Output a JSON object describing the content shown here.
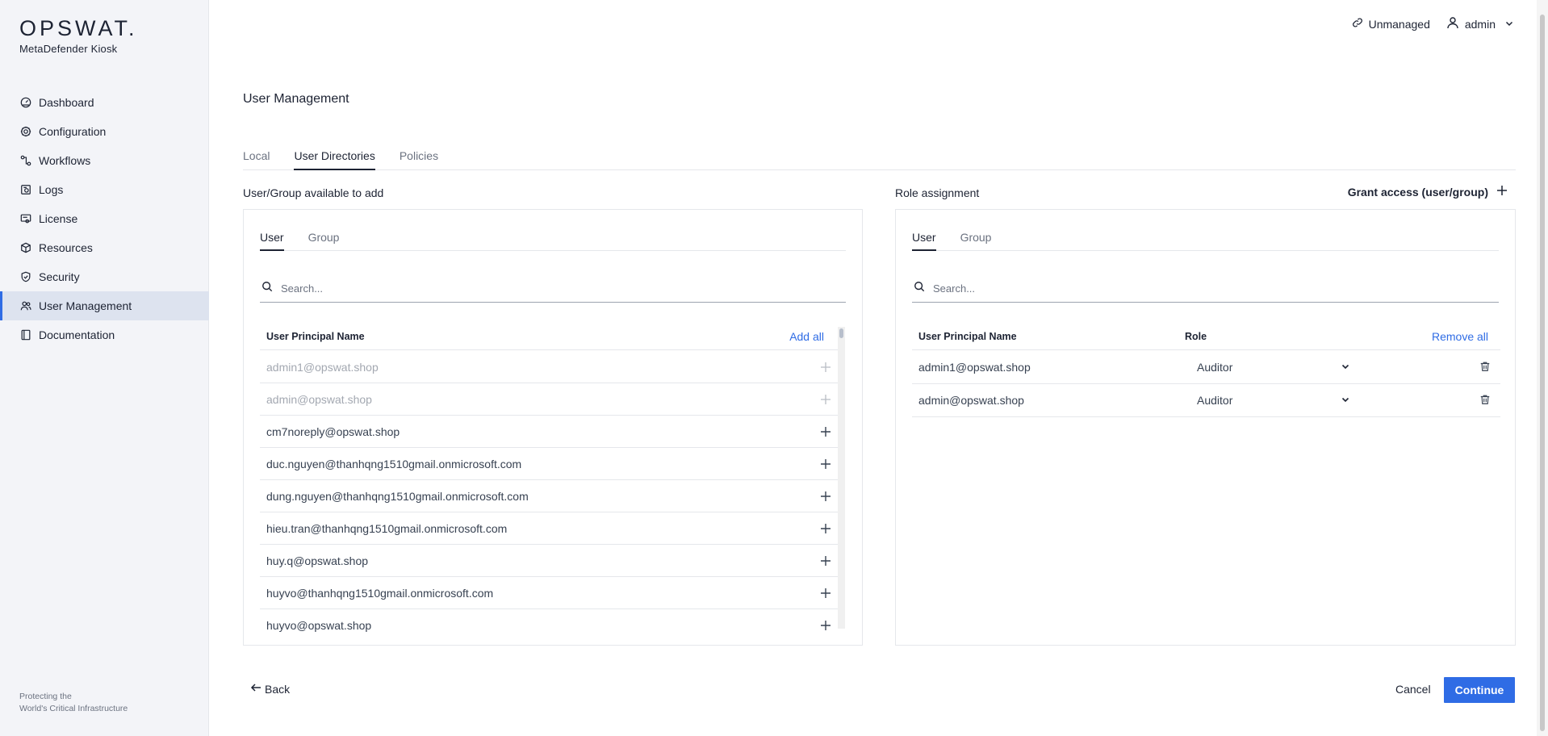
{
  "brand": {
    "logo": "OPSWAT.",
    "product": "MetaDefender Kiosk"
  },
  "sidebar": {
    "items": [
      {
        "label": "Dashboard",
        "icon": "dashboard-icon"
      },
      {
        "label": "Configuration",
        "icon": "gear-icon"
      },
      {
        "label": "Workflows",
        "icon": "workflow-icon"
      },
      {
        "label": "Logs",
        "icon": "logs-icon"
      },
      {
        "label": "License",
        "icon": "license-icon"
      },
      {
        "label": "Resources",
        "icon": "cube-icon"
      },
      {
        "label": "Security",
        "icon": "shield-icon"
      },
      {
        "label": "User Management",
        "icon": "users-icon",
        "active": true
      },
      {
        "label": "Documentation",
        "icon": "book-icon"
      }
    ],
    "footer_line1": "Protecting the",
    "footer_line2": "World's Critical Infrastructure"
  },
  "topbar": {
    "unmanaged_label": "Unmanaged",
    "user_label": "admin"
  },
  "page": {
    "title": "User Management",
    "tabs": [
      "Local",
      "User Directories",
      "Policies"
    ],
    "active_tab": 1
  },
  "left_panel": {
    "title": "User/Group available to add",
    "tabs": [
      "User",
      "Group"
    ],
    "search_placeholder": "Search...",
    "column_header": "User Principal Name",
    "add_all_label": "Add all",
    "rows": [
      {
        "name": "admin1@opswat.shop",
        "disabled": true
      },
      {
        "name": "admin@opswat.shop",
        "disabled": true
      },
      {
        "name": "cm7noreply@opswat.shop",
        "disabled": false
      },
      {
        "name": "duc.nguyen@thanhqng1510gmail.onmicrosoft.com",
        "disabled": false
      },
      {
        "name": "dung.nguyen@thanhqng1510gmail.onmicrosoft.com",
        "disabled": false
      },
      {
        "name": "hieu.tran@thanhqng1510gmail.onmicrosoft.com",
        "disabled": false
      },
      {
        "name": "huy.q@opswat.shop",
        "disabled": false
      },
      {
        "name": "huyvo@thanhqng1510gmail.onmicrosoft.com",
        "disabled": false
      },
      {
        "name": "huyvo@opswat.shop",
        "disabled": false
      }
    ]
  },
  "right_panel": {
    "title": "Role assignment",
    "grant_label": "Grant access (user/group)",
    "tabs": [
      "User",
      "Group"
    ],
    "search_placeholder": "Search...",
    "col_name": "User Principal Name",
    "col_role": "Role",
    "remove_all_label": "Remove all",
    "rows": [
      {
        "name": "admin1@opswat.shop",
        "role": "Auditor"
      },
      {
        "name": "admin@opswat.shop",
        "role": "Auditor"
      }
    ]
  },
  "footer": {
    "back_label": "Back",
    "cancel_label": "Cancel",
    "continue_label": "Continue"
  },
  "colors": {
    "accent": "#2f6ce5",
    "sidebar_bg": "#f3f4f8",
    "active_nav_bg": "#dde3ef"
  }
}
